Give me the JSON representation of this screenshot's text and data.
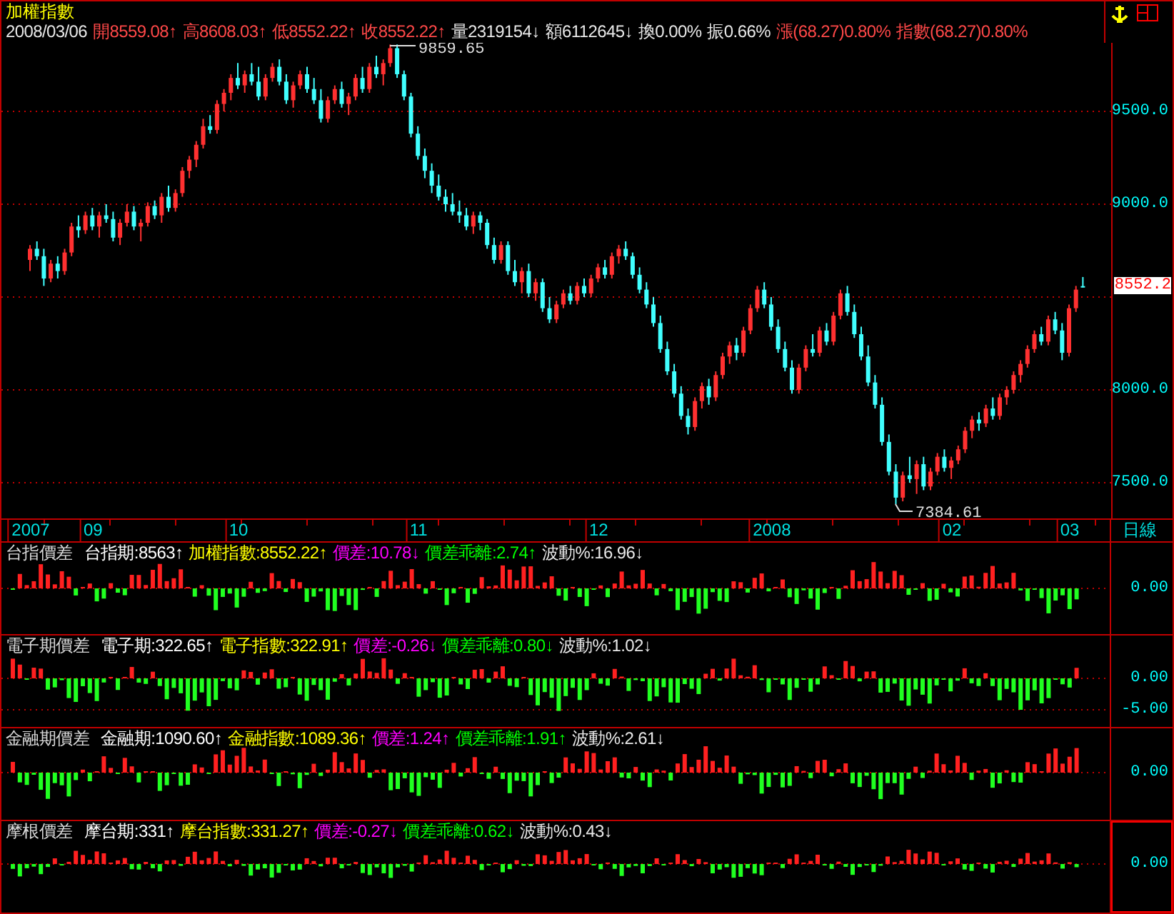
{
  "title": "加權指數",
  "quote": [
    {
      "text": "2008/03/06",
      "color": "#e8e8e8"
    },
    {
      "text": "開8559.08↑",
      "color": "#ff4848"
    },
    {
      "text": "高8608.03↑",
      "color": "#ff4848"
    },
    {
      "text": "低8552.22↑",
      "color": "#ff4848"
    },
    {
      "text": "收8552.22↑",
      "color": "#ff4848"
    },
    {
      "text": "量2319154↓",
      "color": "#e8e8e8"
    },
    {
      "text": "額6112645↓",
      "color": "#e8e8e8"
    },
    {
      "text": "換0.00%",
      "color": "#e8e8e8"
    },
    {
      "text": "振0.66%",
      "color": "#e8e8e8"
    },
    {
      "text": "漲(68.27)0.80%",
      "color": "#ff4848"
    },
    {
      "text": "指數(68.27)0.80%",
      "color": "#ff4848"
    }
  ],
  "main_chart": {
    "last_price": "8552.2",
    "high_label": "9859.65",
    "low_label": "7384.61",
    "chart_data": {
      "type": "candlestick",
      "ylim": [
        7308,
        9869
      ],
      "grid": true,
      "categories": [
        "2007",
        null,
        null,
        null,
        null,
        null,
        null,
        null,
        null,
        "09",
        null,
        null,
        null,
        null,
        null,
        null,
        null,
        null,
        null,
        null,
        null,
        null,
        null,
        null,
        null,
        null,
        null,
        null,
        null,
        null,
        "10",
        null,
        null,
        null,
        null,
        null,
        null,
        null,
        null,
        null,
        null,
        null,
        null,
        null,
        null,
        null,
        null,
        null,
        null,
        null,
        null,
        null,
        null,
        null,
        null,
        null,
        "11",
        null,
        null,
        null,
        null,
        null,
        null,
        null,
        null,
        null,
        null,
        null,
        null,
        null,
        null,
        null,
        null,
        null,
        null,
        null,
        null,
        null,
        null,
        null,
        null,
        null,
        "12",
        null,
        null,
        null,
        null,
        null,
        null,
        null,
        null,
        null,
        null,
        null,
        null,
        null,
        null,
        null,
        null,
        null,
        null,
        null,
        null,
        null,
        null,
        null,
        null,
        "2008",
        null,
        null,
        null,
        null,
        null,
        null,
        null,
        null,
        null,
        null,
        null,
        null,
        null,
        null,
        null,
        null,
        null,
        null,
        null,
        null,
        null,
        null,
        null,
        null,
        null,
        "02",
        null,
        null,
        null,
        null,
        null,
        null,
        null,
        null,
        null,
        null,
        null,
        null,
        null,
        null,
        null,
        null,
        "03",
        null,
        null
      ],
      "yticks": [
        {
          "value": 9500,
          "label": "9500.0"
        },
        {
          "value": 9000,
          "label": "9000.0"
        },
        {
          "value": 8000,
          "label": "8000.0"
        },
        {
          "value": 7500,
          "label": "7500.0"
        }
      ],
      "ohlc": [
        [
          8700,
          8780,
          8640,
          8760
        ],
        [
          8760,
          8800,
          8700,
          8720
        ],
        [
          8720,
          8760,
          8560,
          8600
        ],
        [
          8600,
          8700,
          8580,
          8680
        ],
        [
          8680,
          8720,
          8600,
          8640
        ],
        [
          8640,
          8760,
          8620,
          8740
        ],
        [
          8740,
          8900,
          8720,
          8880
        ],
        [
          8880,
          8940,
          8820,
          8860
        ],
        [
          8860,
          8960,
          8840,
          8940
        ],
        [
          8940,
          8980,
          8860,
          8880
        ],
        [
          8880,
          8960,
          8820,
          8940
        ],
        [
          8940,
          9000,
          8900,
          8920
        ],
        [
          8920,
          8960,
          8800,
          8820
        ],
        [
          8820,
          8920,
          8780,
          8900
        ],
        [
          8900,
          9000,
          8880,
          8960
        ],
        [
          8960,
          8990,
          8860,
          8880
        ],
        [
          8880,
          8920,
          8800,
          8900
        ],
        [
          8900,
          9010,
          8880,
          8990
        ],
        [
          8990,
          9020,
          8920,
          8940
        ],
        [
          8940,
          9060,
          8900,
          9040
        ],
        [
          9040,
          9100,
          8960,
          8980
        ],
        [
          8980,
          9080,
          8960,
          9060
        ],
        [
          9060,
          9200,
          9040,
          9180
        ],
        [
          9180,
          9260,
          9140,
          9240
        ],
        [
          9240,
          9340,
          9200,
          9320
        ],
        [
          9320,
          9460,
          9300,
          9420
        ],
        [
          9420,
          9480,
          9380,
          9400
        ],
        [
          9400,
          9560,
          9380,
          9540
        ],
        [
          9540,
          9620,
          9500,
          9600
        ],
        [
          9600,
          9700,
          9560,
          9680
        ],
        [
          9680,
          9760,
          9620,
          9640
        ],
        [
          9640,
          9720,
          9600,
          9700
        ],
        [
          9700,
          9760,
          9640,
          9660
        ],
        [
          9660,
          9740,
          9560,
          9580
        ],
        [
          9580,
          9700,
          9560,
          9680
        ],
        [
          9680,
          9760,
          9660,
          9740
        ],
        [
          9740,
          9780,
          9640,
          9660
        ],
        [
          9660,
          9700,
          9540,
          9560
        ],
        [
          9560,
          9660,
          9520,
          9640
        ],
        [
          9640,
          9720,
          9620,
          9700
        ],
        [
          9700,
          9740,
          9600,
          9620
        ],
        [
          9620,
          9680,
          9540,
          9560
        ],
        [
          9560,
          9620,
          9440,
          9460
        ],
        [
          9460,
          9580,
          9440,
          9560
        ],
        [
          9560,
          9640,
          9540,
          9620
        ],
        [
          9620,
          9660,
          9520,
          9540
        ],
        [
          9540,
          9600,
          9480,
          9580
        ],
        [
          9580,
          9700,
          9560,
          9680
        ],
        [
          9680,
          9740,
          9600,
          9620
        ],
        [
          9620,
          9760,
          9600,
          9740
        ],
        [
          9740,
          9800,
          9680,
          9700
        ],
        [
          9700,
          9780,
          9640,
          9760
        ],
        [
          9760,
          9860,
          9740,
          9840
        ],
        [
          9840,
          9860,
          9680,
          9700
        ],
        [
          9700,
          9720,
          9560,
          9580
        ],
        [
          9580,
          9600,
          9360,
          9380
        ],
        [
          9380,
          9420,
          9240,
          9260
        ],
        [
          9260,
          9300,
          9140,
          9180
        ],
        [
          9180,
          9220,
          9060,
          9100
        ],
        [
          9100,
          9160,
          9020,
          9040
        ],
        [
          9040,
          9080,
          8960,
          9000
        ],
        [
          9000,
          9060,
          8940,
          8960
        ],
        [
          8960,
          9020,
          8900,
          8940
        ],
        [
          8940,
          8980,
          8860,
          8880
        ],
        [
          8880,
          8960,
          8840,
          8940
        ],
        [
          8940,
          8960,
          8860,
          8900
        ],
        [
          8900,
          8920,
          8760,
          8780
        ],
        [
          8780,
          8820,
          8680,
          8700
        ],
        [
          8700,
          8800,
          8680,
          8780
        ],
        [
          8780,
          8800,
          8620,
          8640
        ],
        [
          8640,
          8700,
          8560,
          8580
        ],
        [
          8580,
          8660,
          8520,
          8640
        ],
        [
          8640,
          8680,
          8500,
          8520
        ],
        [
          8520,
          8600,
          8480,
          8580
        ],
        [
          8580,
          8600,
          8420,
          8440
        ],
        [
          8440,
          8500,
          8360,
          8380
        ],
        [
          8380,
          8480,
          8360,
          8460
        ],
        [
          8460,
          8540,
          8440,
          8520
        ],
        [
          8520,
          8560,
          8460,
          8480
        ],
        [
          8480,
          8580,
          8460,
          8560
        ],
        [
          8560,
          8600,
          8500,
          8520
        ],
        [
          8520,
          8620,
          8500,
          8600
        ],
        [
          8600,
          8680,
          8580,
          8660
        ],
        [
          8660,
          8700,
          8600,
          8620
        ],
        [
          8620,
          8740,
          8600,
          8720
        ],
        [
          8720,
          8780,
          8680,
          8760
        ],
        [
          8760,
          8800,
          8700,
          8720
        ],
        [
          8720,
          8740,
          8600,
          8620
        ],
        [
          8620,
          8660,
          8520,
          8540
        ],
        [
          8540,
          8580,
          8440,
          8460
        ],
        [
          8460,
          8500,
          8340,
          8360
        ],
        [
          8360,
          8400,
          8200,
          8220
        ],
        [
          8220,
          8260,
          8080,
          8100
        ],
        [
          8100,
          8140,
          7960,
          7980
        ],
        [
          7980,
          8020,
          7840,
          7860
        ],
        [
          7860,
          7900,
          7760,
          7800
        ],
        [
          7800,
          7960,
          7780,
          7940
        ],
        [
          7940,
          8040,
          7900,
          8020
        ],
        [
          8020,
          8060,
          7920,
          7960
        ],
        [
          7960,
          8100,
          7940,
          8080
        ],
        [
          8080,
          8200,
          8060,
          8180
        ],
        [
          8180,
          8260,
          8140,
          8240
        ],
        [
          8240,
          8280,
          8160,
          8200
        ],
        [
          8200,
          8340,
          8180,
          8320
        ],
        [
          8320,
          8460,
          8300,
          8440
        ],
        [
          8440,
          8560,
          8420,
          8540
        ],
        [
          8540,
          8580,
          8440,
          8460
        ],
        [
          8460,
          8500,
          8320,
          8340
        ],
        [
          8340,
          8380,
          8200,
          8220
        ],
        [
          8220,
          8260,
          8100,
          8120
        ],
        [
          8120,
          8160,
          7980,
          8000
        ],
        [
          8000,
          8140,
          7980,
          8120
        ],
        [
          8120,
          8240,
          8100,
          8220
        ],
        [
          8220,
          8300,
          8180,
          8200
        ],
        [
          8200,
          8340,
          8180,
          8320
        ],
        [
          8320,
          8360,
          8240,
          8260
        ],
        [
          8260,
          8420,
          8240,
          8400
        ],
        [
          8400,
          8540,
          8380,
          8520
        ],
        [
          8520,
          8560,
          8400,
          8420
        ],
        [
          8420,
          8460,
          8280,
          8300
        ],
        [
          8300,
          8340,
          8160,
          8180
        ],
        [
          8180,
          8240,
          8020,
          8040
        ],
        [
          8040,
          8080,
          7900,
          7920
        ],
        [
          7920,
          7960,
          7700,
          7720
        ],
        [
          7720,
          7760,
          7540,
          7560
        ],
        [
          7560,
          7600,
          7385,
          7420
        ],
        [
          7420,
          7560,
          7400,
          7540
        ],
        [
          7540,
          7640,
          7500,
          7520
        ],
        [
          7520,
          7620,
          7440,
          7600
        ],
        [
          7600,
          7640,
          7460,
          7480
        ],
        [
          7480,
          7580,
          7460,
          7560
        ],
        [
          7560,
          7660,
          7540,
          7640
        ],
        [
          7640,
          7680,
          7560,
          7580
        ],
        [
          7580,
          7640,
          7520,
          7620
        ],
        [
          7620,
          7700,
          7600,
          7680
        ],
        [
          7680,
          7800,
          7660,
          7780
        ],
        [
          7780,
          7860,
          7740,
          7840
        ],
        [
          7840,
          7880,
          7780,
          7820
        ],
        [
          7820,
          7920,
          7800,
          7900
        ],
        [
          7900,
          7960,
          7840,
          7860
        ],
        [
          7860,
          7980,
          7840,
          7960
        ],
        [
          7960,
          8020,
          7920,
          8000
        ],
        [
          8000,
          8100,
          7980,
          8080
        ],
        [
          8080,
          8160,
          8040,
          8140
        ],
        [
          8140,
          8240,
          8120,
          8220
        ],
        [
          8220,
          8320,
          8200,
          8300
        ],
        [
          8300,
          8340,
          8240,
          8260
        ],
        [
          8260,
          8400,
          8240,
          8380
        ],
        [
          8380,
          8420,
          8300,
          8320
        ],
        [
          8320,
          8360,
          8160,
          8200
        ],
        [
          8200,
          8460,
          8180,
          8440
        ],
        [
          8440,
          8560,
          8420,
          8540
        ],
        [
          8559,
          8608,
          8552,
          8552
        ]
      ]
    }
  },
  "date_axis": {
    "period": "日線"
  },
  "panels": [
    {
      "title": "台指價差",
      "selected": false,
      "axis_labels": [
        "0.00"
      ],
      "values": [
        {
          "text": "台指期:8563↑",
          "color": "#ffffff"
        },
        {
          "text": "加權指數:8552.22↑",
          "color": "#ffff00"
        },
        {
          "text": "價差:10.78↓",
          "color": "#ff00ff"
        },
        {
          "text": "價差乖離:2.74↑",
          "color": "#00ff00"
        },
        {
          "text": "波動%:16.96↓",
          "color": "#e8e8e8"
        }
      ]
    },
    {
      "title": "電子期價差",
      "selected": false,
      "axis_labels": [
        "0.00",
        "-5.00"
      ],
      "values": [
        {
          "text": "電子期:322.65↑",
          "color": "#ffffff"
        },
        {
          "text": "電子指數:322.91↑",
          "color": "#ffff00"
        },
        {
          "text": "價差:-0.26↓",
          "color": "#ff00ff"
        },
        {
          "text": "價差乖離:0.80↓",
          "color": "#00ff00"
        },
        {
          "text": "波動%:1.02↓",
          "color": "#e8e8e8"
        }
      ]
    },
    {
      "title": "金融期價差",
      "selected": false,
      "axis_labels": [
        "0.00"
      ],
      "values": [
        {
          "text": "金融期:1090.60↑",
          "color": "#ffffff"
        },
        {
          "text": "金融指數:1089.36↑",
          "color": "#ffff00"
        },
        {
          "text": "價差:1.24↑",
          "color": "#ff00ff"
        },
        {
          "text": "價差乖離:1.91↑",
          "color": "#00ff00"
        },
        {
          "text": "波動%:2.61↓",
          "color": "#e8e8e8"
        }
      ]
    },
    {
      "title": "摩根價差",
      "selected": true,
      "axis_labels": [
        "0.00"
      ],
      "values": [
        {
          "text": "摩台期:331↑",
          "color": "#ffffff"
        },
        {
          "text": "摩台指數:331.27↑",
          "color": "#ffff00"
        },
        {
          "text": "價差:-0.27↓",
          "color": "#ff00ff"
        },
        {
          "text": "價差乖離:0.62↓",
          "color": "#00ff00"
        },
        {
          "text": "波動%:0.43↓",
          "color": "#e8e8e8"
        }
      ]
    }
  ]
}
